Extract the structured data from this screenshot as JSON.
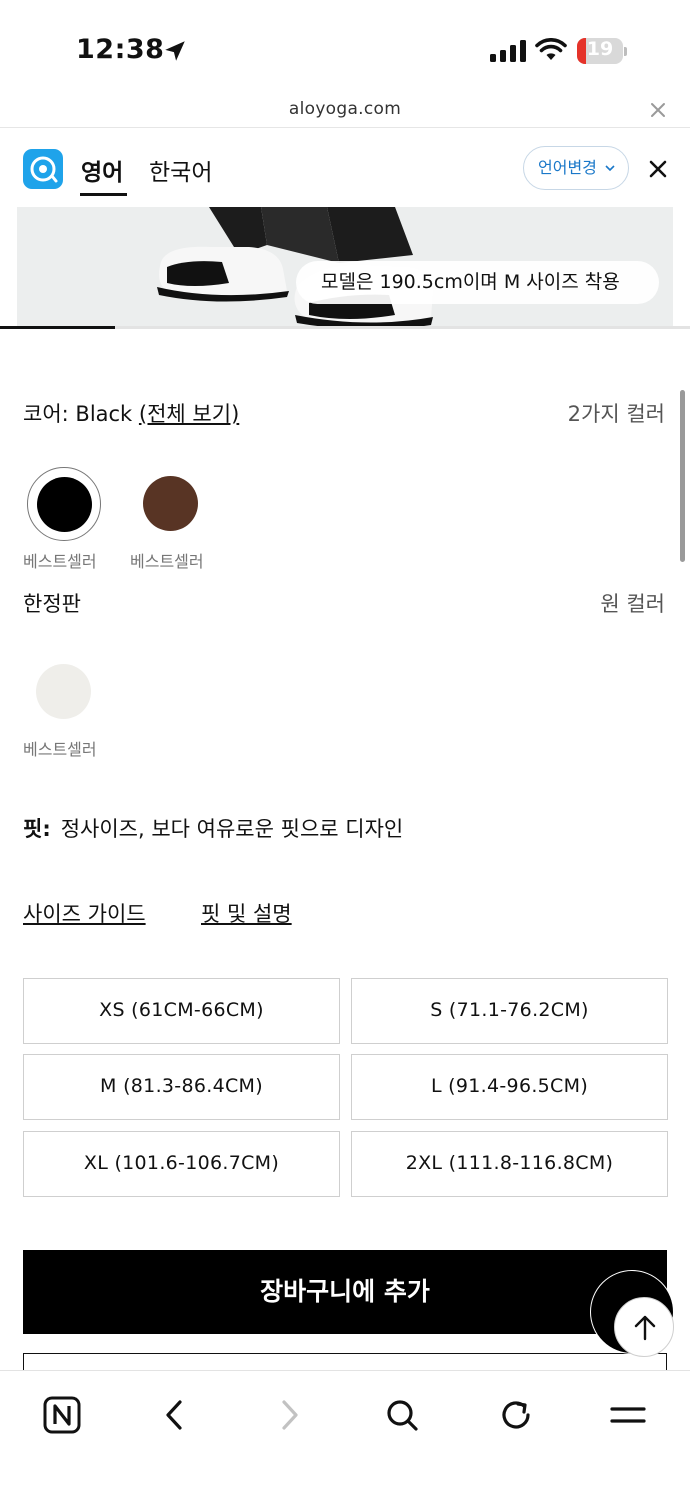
{
  "status_bar": {
    "time": "12:38",
    "battery_level": "19",
    "battery_fraction": 0.19,
    "icons": [
      "location-arrow-icon",
      "signal-bars-icon",
      "wifi-icon",
      "battery-icon"
    ]
  },
  "browser": {
    "url": "aloyoga.com"
  },
  "translate_bar": {
    "source_lang": "영어",
    "target_lang": "한국어",
    "change_language": "언어변경"
  },
  "hero": {
    "model_caption": "모델은 190.5cm이며 M 사이즈 착용"
  },
  "colors": {
    "core_prefix": "코어:",
    "core_selected": "Black",
    "view_all": "(전체 보기)",
    "core_count": "2가지 컬러",
    "core_swatches": [
      {
        "name": "Black",
        "color": "#000000",
        "caption": "베스트셀러",
        "selected": true
      },
      {
        "name": "Brown",
        "color": "#583424",
        "caption": "베스트셀러",
        "selected": false
      }
    ],
    "limited_label": "한정판",
    "limited_count": "원 컬러",
    "limited_swatches": [
      {
        "name": "Ivory",
        "color": "#efeeea",
        "caption": "베스트셀러",
        "selected": false
      }
    ]
  },
  "fit": {
    "label": "핏:",
    "text": "정사이즈, 보다 여유로운 핏으로 디자인"
  },
  "links": {
    "size_guide": "사이즈 가이드",
    "fit_desc": "핏 및 설명"
  },
  "sizes": [
    "XS (61CM-66CM)",
    "S (71.1-76.2CM)",
    "M (81.3-86.4CM)",
    "L (91.4-96.5CM)",
    "XL (101.6-106.7CM)",
    "2XL (111.8-116.8CM)"
  ],
  "actions": {
    "add_to_cart": "장바구니에 추가"
  },
  "toolbar": {
    "icons": [
      "naver-n-icon",
      "back-arrow-icon",
      "forward-arrow-icon",
      "search-icon",
      "refresh-icon",
      "menu-icon"
    ]
  }
}
